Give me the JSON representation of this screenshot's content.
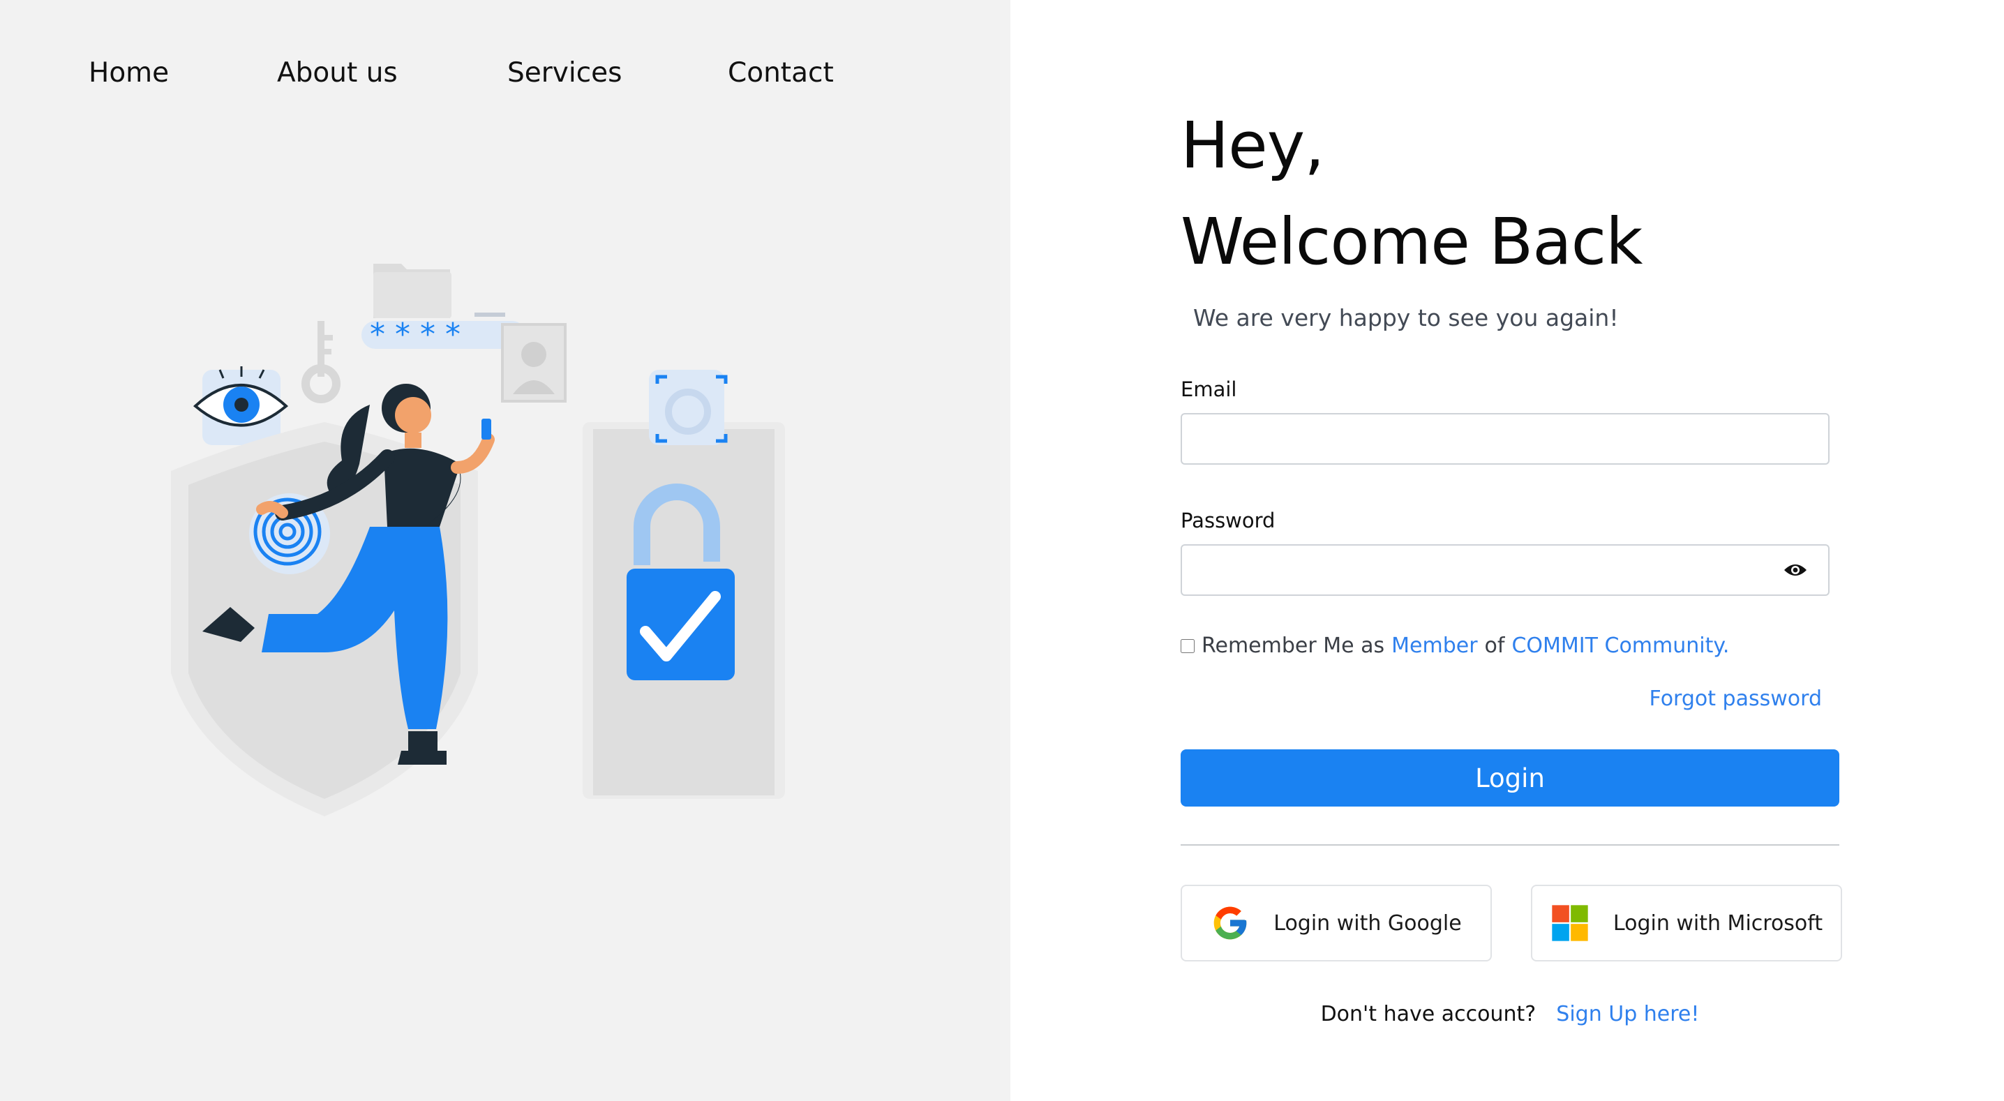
{
  "nav": {
    "items": [
      {
        "label": "Home"
      },
      {
        "label": "About us"
      },
      {
        "label": "Services"
      },
      {
        "label": "Contact"
      }
    ]
  },
  "illustration": {
    "password_stars": "* * * *"
  },
  "form": {
    "heading_line1": "Hey,",
    "heading_line2": "Welcome Back",
    "subheading": "We are very happy to see you again!",
    "email_label": "Email",
    "email_value": "",
    "password_label": "Password",
    "password_value": "",
    "remember": {
      "prefix": "Remember Me as",
      "member_link": "Member",
      "of_text": "of",
      "community_link": "COMMIT Community.",
      "checked": false
    },
    "forgot_password": "Forgot password",
    "login_button": "Login",
    "google_button": "Login with Google",
    "microsoft_button": "Login with Microsoft",
    "signup_prompt": "Don't have account?",
    "signup_link": "Sign Up here!"
  },
  "colors": {
    "accent": "#1a82f2",
    "link": "#2f80ed",
    "left_panel_bg": "#f2f2f2"
  },
  "icons": {
    "password_toggle": "eye-icon",
    "google": "google-g-icon",
    "microsoft": "microsoft-logo-icon"
  }
}
